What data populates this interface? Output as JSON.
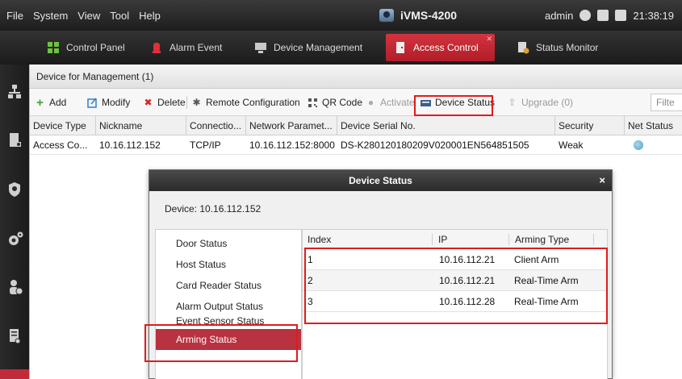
{
  "menubar": {
    "menus": [
      "File",
      "System",
      "View",
      "Tool",
      "Help"
    ],
    "app_title": "iVMS-4200",
    "user": "admin",
    "time": "21:38:19"
  },
  "tabs": [
    {
      "label": "Control Panel",
      "icon": "control-panel-icon"
    },
    {
      "label": "Alarm Event",
      "icon": "alarm-icon"
    },
    {
      "label": "Device Management",
      "icon": "device-management-icon"
    },
    {
      "label": "Access Control",
      "icon": "access-control-icon",
      "active": true
    },
    {
      "label": "Status Monitor",
      "icon": "status-monitor-icon"
    }
  ],
  "rail_icons": [
    "device-tree-icon",
    "door-icon",
    "shield-icon",
    "gear-icon",
    "person-icon",
    "report-icon"
  ],
  "section_title": "Device for Management (1)",
  "toolbar": {
    "add": "Add",
    "modify": "Modify",
    "delete": "Delete",
    "remote_config": "Remote Configuration",
    "qr_code": "QR Code",
    "activate": "Activate",
    "device_status": "Device Status",
    "upgrade": "Upgrade (0)",
    "filter": "Filte"
  },
  "device_table": {
    "columns": [
      "Device Type",
      "Nickname",
      "Connectio...",
      "Network Paramet...",
      "Device Serial No.",
      "Security",
      "Net Status"
    ],
    "rows": [
      [
        "Access Co...",
        "10.16.112.152",
        "TCP/IP",
        "10.16.112.152:8000",
        "DS-K280120180209V020001EN564851505",
        "Weak",
        ""
      ]
    ]
  },
  "dialog": {
    "title": "Device Status",
    "close": "×",
    "device_label": "Device: 10.16.112.152",
    "nav": [
      "Door Status",
      "Host Status",
      "Card Reader Status",
      "Alarm Output Status",
      "Event Sensor Status",
      "Arming Status"
    ],
    "active_nav": "Arming Status",
    "columns": [
      "Index",
      "IP",
      "Arming Type"
    ],
    "rows": [
      [
        "1",
        "10.16.112.21",
        "Client Arm"
      ],
      [
        "2",
        "10.16.112.21",
        "Real-Time Arm"
      ],
      [
        "3",
        "10.16.112.28",
        "Real-Time Arm"
      ]
    ]
  },
  "colors": {
    "accent_red": "#c2293a",
    "highlight_box": "#e01b1b",
    "online": "#4d9fbd"
  }
}
